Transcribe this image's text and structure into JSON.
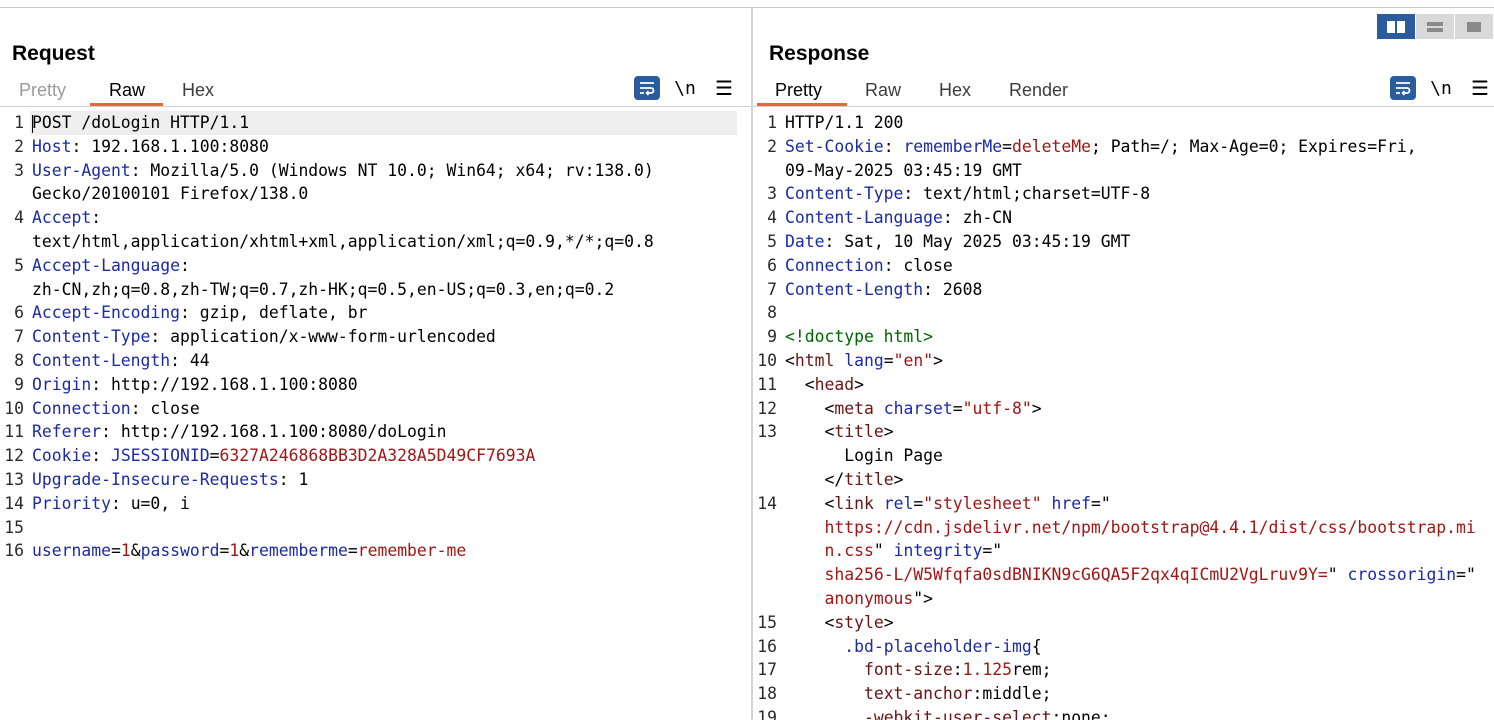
{
  "layout_toggle": {
    "active": "side-by-side",
    "options": [
      "side-by-side-icon",
      "stacked-icon",
      "single-icon"
    ]
  },
  "request": {
    "title": "Request",
    "tabs": [
      "Pretty",
      "Raw",
      "Hex"
    ],
    "active_tab": "Raw",
    "toolbar": {
      "newline_label": "\\n",
      "menu_label": "☰"
    },
    "lines": [
      {
        "n": "1",
        "text": "POST /doLogin HTTP/1.1"
      },
      {
        "n": "2",
        "header": "Host",
        "value": ": 192.168.1.100:8080"
      },
      {
        "n": "3",
        "header": "User-Agent",
        "value": ": Mozilla/5.0 (Windows NT 10.0; Win64; x64; rv:138.0)"
      },
      {
        "n": "",
        "text": "Gecko/20100101 Firefox/138.0"
      },
      {
        "n": "4",
        "header": "Accept",
        "value": ":"
      },
      {
        "n": "",
        "text": "text/html,application/xhtml+xml,application/xml;q=0.9,*/*;q=0.8"
      },
      {
        "n": "5",
        "header": "Accept-Language",
        "value": ":"
      },
      {
        "n": "",
        "text": "zh-CN,zh;q=0.8,zh-TW;q=0.7,zh-HK;q=0.5,en-US;q=0.3,en;q=0.2"
      },
      {
        "n": "6",
        "header": "Accept-Encoding",
        "value": ": gzip, deflate, br"
      },
      {
        "n": "7",
        "header": "Content-Type",
        "value": ": application/x-www-form-urlencoded"
      },
      {
        "n": "8",
        "header": "Content-Length",
        "value": ": 44"
      },
      {
        "n": "9",
        "header": "Origin",
        "value": ": http://192.168.1.100:8080"
      },
      {
        "n": "10",
        "header": "Connection",
        "value": ": close"
      },
      {
        "n": "11",
        "header": "Referer",
        "value": ": http://192.168.1.100:8080/doLogin"
      },
      {
        "n": "12",
        "header": "Cookie",
        "value": ": ",
        "cookie_name": "JSESSIONID",
        "cookie_eq": "=",
        "cookie_value": "6327A246868BB3D2A328A5D49CF7693A"
      },
      {
        "n": "13",
        "header": "Upgrade-Insecure-Requests",
        "value": ": 1"
      },
      {
        "n": "14",
        "header": "Priority",
        "value": ": u=0, i"
      },
      {
        "n": "15",
        "text": ""
      },
      {
        "n": "16",
        "params": [
          [
            "username",
            "1"
          ],
          [
            "password",
            "1"
          ],
          [
            "rememberme",
            "remember-me"
          ]
        ]
      }
    ]
  },
  "response": {
    "title": "Response",
    "tabs": [
      "Pretty",
      "Raw",
      "Hex",
      "Render"
    ],
    "active_tab": "Pretty",
    "toolbar": {
      "newline_label": "\\n",
      "menu_label": "☰"
    },
    "lines": [
      {
        "n": "1",
        "text": "HTTP/1.1 200"
      },
      {
        "n": "2",
        "header": "Set-Cookie",
        "value": ": ",
        "cookie_name": "rememberMe",
        "cookie_eq": "=",
        "cookie_value": "deleteMe",
        "rest": "; Path=/; Max-Age=0; Expires=Fri,"
      },
      {
        "n": "",
        "text": "09-May-2025 03:45:19 GMT"
      },
      {
        "n": "3",
        "header": "Content-Type",
        "value": ": text/html;charset=UTF-8"
      },
      {
        "n": "4",
        "header": "Content-Language",
        "value": ": zh-CN"
      },
      {
        "n": "5",
        "header": "Date",
        "value": ": Sat, 10 May 2025 03:45:19 GMT"
      },
      {
        "n": "6",
        "header": "Connection",
        "value": ": close"
      },
      {
        "n": "7",
        "header": "Content-Length",
        "value": ": 2608"
      },
      {
        "n": "8",
        "text": ""
      },
      {
        "n": "9",
        "doctype": "<!doctype html>"
      },
      {
        "n": "10",
        "html": [
          [
            "p",
            "<"
          ],
          [
            "t",
            "html"
          ],
          [
            "s",
            " "
          ],
          [
            "a",
            "lang"
          ],
          [
            "p",
            "="
          ],
          [
            "v",
            "\"en\""
          ],
          [
            "p",
            ">"
          ]
        ]
      },
      {
        "n": "11",
        "html": [
          [
            "s",
            "  "
          ],
          [
            "p",
            "<"
          ],
          [
            "t",
            "head"
          ],
          [
            "p",
            ">"
          ]
        ]
      },
      {
        "n": "12",
        "html": [
          [
            "s",
            "    "
          ],
          [
            "p",
            "<"
          ],
          [
            "t",
            "meta"
          ],
          [
            "s",
            " "
          ],
          [
            "a",
            "charset"
          ],
          [
            "p",
            "="
          ],
          [
            "v",
            "\"utf-8\""
          ],
          [
            "p",
            ">"
          ]
        ]
      },
      {
        "n": "13",
        "html": [
          [
            "s",
            "    "
          ],
          [
            "p",
            "<"
          ],
          [
            "t",
            "title"
          ],
          [
            "p",
            ">"
          ]
        ]
      },
      {
        "n": "",
        "html": [
          [
            "s",
            "      "
          ],
          [
            "x",
            "Login Page"
          ]
        ]
      },
      {
        "n": "",
        "html": [
          [
            "s",
            "    "
          ],
          [
            "p",
            "</"
          ],
          [
            "t",
            "title"
          ],
          [
            "p",
            ">"
          ]
        ]
      },
      {
        "n": "14",
        "html": [
          [
            "s",
            "    "
          ],
          [
            "p",
            "<"
          ],
          [
            "t",
            "link"
          ],
          [
            "s",
            " "
          ],
          [
            "a",
            "rel"
          ],
          [
            "p",
            "="
          ],
          [
            "v",
            "\"stylesheet\""
          ],
          [
            "s",
            " "
          ],
          [
            "a",
            "href"
          ],
          [
            "p",
            "=\""
          ]
        ]
      },
      {
        "n": "",
        "html": [
          [
            "s",
            "    "
          ],
          [
            "v",
            "https://cdn.jsdelivr.net/npm/bootstrap@4.4.1/dist/css/bootstrap.mi"
          ]
        ]
      },
      {
        "n": "",
        "html": [
          [
            "s",
            "    "
          ],
          [
            "v",
            "n.css"
          ],
          [
            "p",
            "\" "
          ],
          [
            "a",
            "integrity"
          ],
          [
            "p",
            "=\""
          ]
        ]
      },
      {
        "n": "",
        "html": [
          [
            "s",
            "    "
          ],
          [
            "v",
            "sha256-L/W5Wfqfa0sdBNIKN9cG6QA5F2qx4qICmU2VgLruv9Y="
          ],
          [
            "p",
            "\" "
          ],
          [
            "a",
            "crossorigin"
          ],
          [
            "p",
            "=\""
          ]
        ]
      },
      {
        "n": "",
        "html": [
          [
            "s",
            "    "
          ],
          [
            "v",
            "anonymous"
          ],
          [
            "p",
            "\">"
          ]
        ]
      },
      {
        "n": "15",
        "html": [
          [
            "s",
            "    "
          ],
          [
            "p",
            "<"
          ],
          [
            "t",
            "style"
          ],
          [
            "p",
            ">"
          ]
        ]
      },
      {
        "n": "16",
        "html": [
          [
            "s",
            "      "
          ],
          [
            "c",
            ".bd-placeholder-img"
          ],
          [
            "p",
            "{"
          ]
        ]
      },
      {
        "n": "17",
        "html": [
          [
            "s",
            "        "
          ],
          [
            "t",
            "font-size"
          ],
          [
            "p",
            ":"
          ],
          [
            "v",
            "1.125"
          ],
          [
            "p",
            "rem;"
          ]
        ]
      },
      {
        "n": "18",
        "html": [
          [
            "s",
            "        "
          ],
          [
            "t",
            "text-anchor"
          ],
          [
            "p",
            ":middle;"
          ]
        ]
      },
      {
        "n": "19",
        "html": [
          [
            "s",
            "        "
          ],
          [
            "t",
            "-webkit-user-select"
          ],
          [
            "p",
            ":none;"
          ]
        ]
      }
    ]
  }
}
